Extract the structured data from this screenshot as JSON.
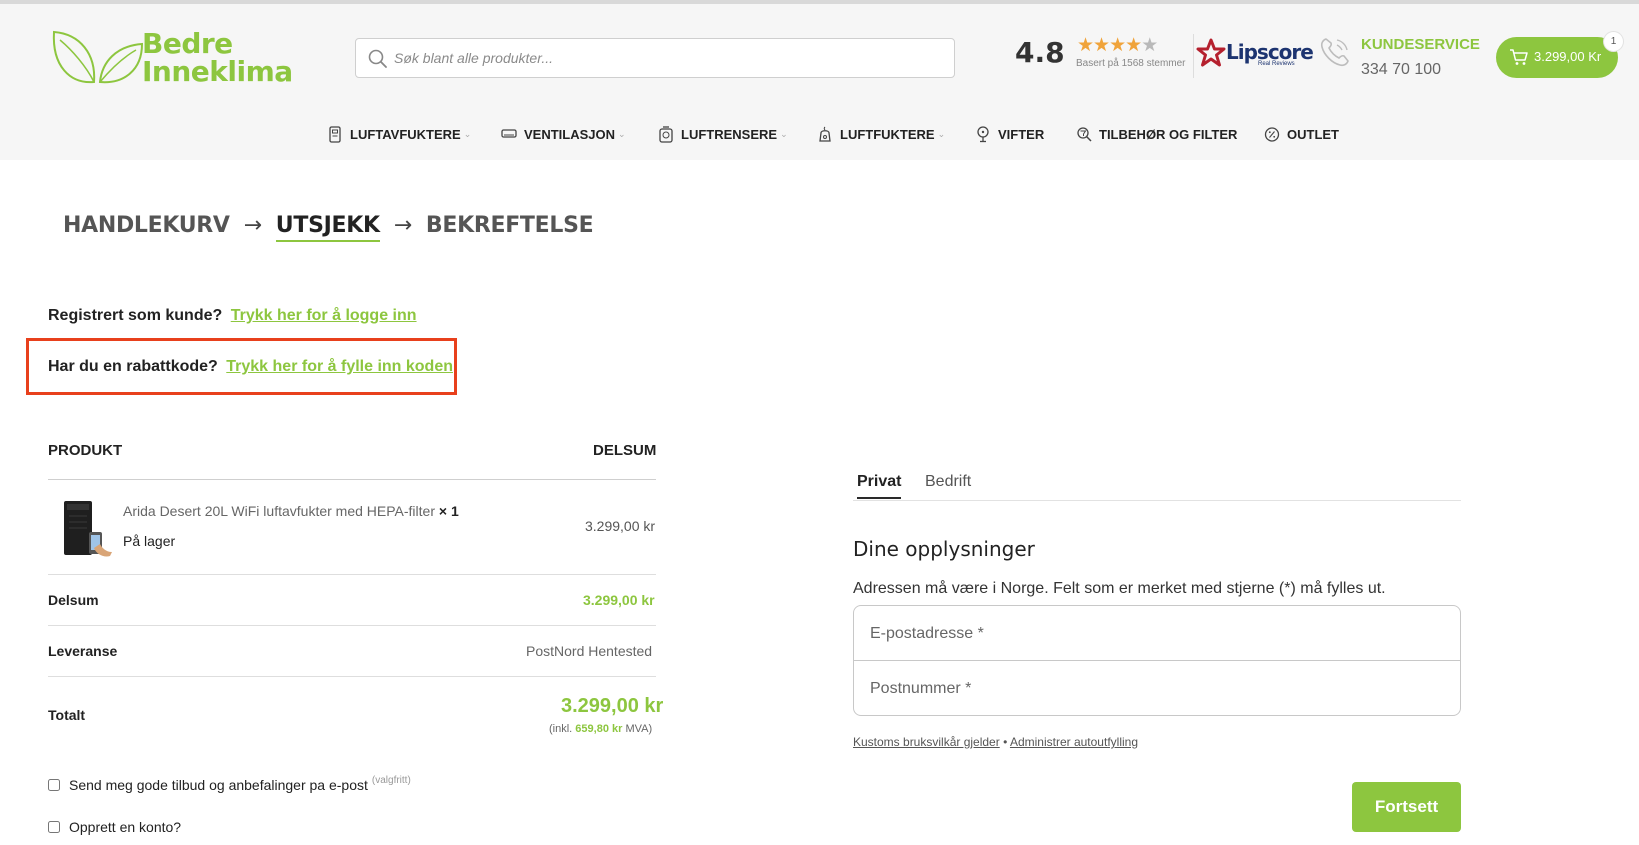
{
  "header": {
    "logo_line1": "Bedre",
    "logo_line2": "Inneklima",
    "search_placeholder": "Søk blant alle produkter...",
    "rating_value": "4.8",
    "rating_stars": 4.5,
    "rating_sub": "Basert på 1568 stemmer",
    "lipscore_brand": "Lipscore",
    "lipscore_tagline": "Real Reviews",
    "customer_service_label": "KUNDESERVICE",
    "customer_service_phone": "334 70 100",
    "cart_amount": "3.299,00 Kr",
    "cart_count": "1",
    "brand_color": "#8dc63f"
  },
  "nav": {
    "items": [
      {
        "label": "LUFTAVFUKTERE",
        "icon": "dehumidifier-icon",
        "has_dropdown": true
      },
      {
        "label": "VENTILASJON",
        "icon": "air-conditioner-icon",
        "has_dropdown": true
      },
      {
        "label": "LUFTRENSERE",
        "icon": "air-purifier-icon",
        "has_dropdown": true
      },
      {
        "label": "LUFTFUKTERE",
        "icon": "humidifier-icon",
        "has_dropdown": true
      },
      {
        "label": "VIFTER",
        "icon": "fan-icon",
        "has_dropdown": false
      },
      {
        "label": "TILBEHØR OG FILTER",
        "icon": "filter-search-icon",
        "has_dropdown": false
      },
      {
        "label": "OUTLET",
        "icon": "discount-icon",
        "has_dropdown": false
      }
    ]
  },
  "steps": {
    "step1": "HANDLEKURV",
    "step2": "UTSJEKK",
    "step3": "BEKREFTELSE",
    "arrow": "→"
  },
  "notices": {
    "login_text": "Registrert som kunde?",
    "login_link": "Trykk her for å logge inn",
    "coupon_text": "Har du en rabattkode?",
    "coupon_link": "Trykk her for å fylle inn koden"
  },
  "order": {
    "col_product": "PRODUKT",
    "col_subtotal": "DELSUM",
    "product_name": "Arida Desert 20L WiFi luftavfukter med HEPA-filter",
    "product_qty": "× 1",
    "product_stock": "På lager",
    "product_price": "3.299,00 kr",
    "subtotal_label": "Delsum",
    "subtotal_value": "3.299,00 kr",
    "shipping_label": "Leveranse",
    "shipping_value": "PostNord Hentested",
    "total_label": "Totalt",
    "total_value": "3.299,00 kr",
    "vat_prefix": "(inkl.",
    "vat_amount": "659,80 kr",
    "vat_suffix": "MVA)",
    "newsletter_label": "Send meg gode tilbud og anbefalinger pa e-post",
    "newsletter_optional": "(valgfritt)",
    "create_account_label": "Opprett en konto?"
  },
  "form": {
    "tab_private": "Privat",
    "tab_business": "Bedrift",
    "title": "Dine opplysninger",
    "note": "Adressen må være i Norge. Felt som er merket med stjerne (*) må fylles ut.",
    "email_placeholder": "E-postadresse *",
    "postal_placeholder": "Postnummer *",
    "terms_link": "Kustoms bruksvilkår gjelder",
    "terms_sep": "•",
    "autofill_link": "Administrer autoutfylling",
    "continue_button": "Fortsett"
  }
}
